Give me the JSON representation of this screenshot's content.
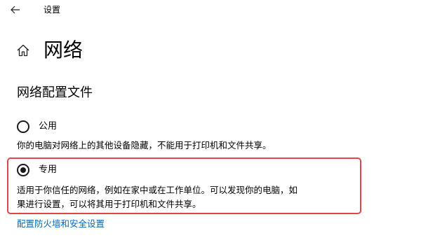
{
  "window": {
    "title": "设置"
  },
  "icons": {
    "back": "back-arrow-icon",
    "home": "home-icon"
  },
  "header": {
    "title": "网络"
  },
  "network_profile": {
    "section_title": "网络配置文件",
    "options": [
      {
        "label": "公用",
        "selected": false,
        "description": "你的电脑对网络上的其他设备隐藏，不能用于打印机和文件共享。"
      },
      {
        "label": "专用",
        "selected": true,
        "description_line1": "适用于你信任的网络，例如在家中或在工作单位。可以发现你的电脑，如",
        "description_line2": "果进行设置，可以将其用于打印机和文件共享。"
      }
    ],
    "link": "配置防火墙和安全设置"
  },
  "colors": {
    "highlight": "#e0474c",
    "link": "#0067c0"
  }
}
